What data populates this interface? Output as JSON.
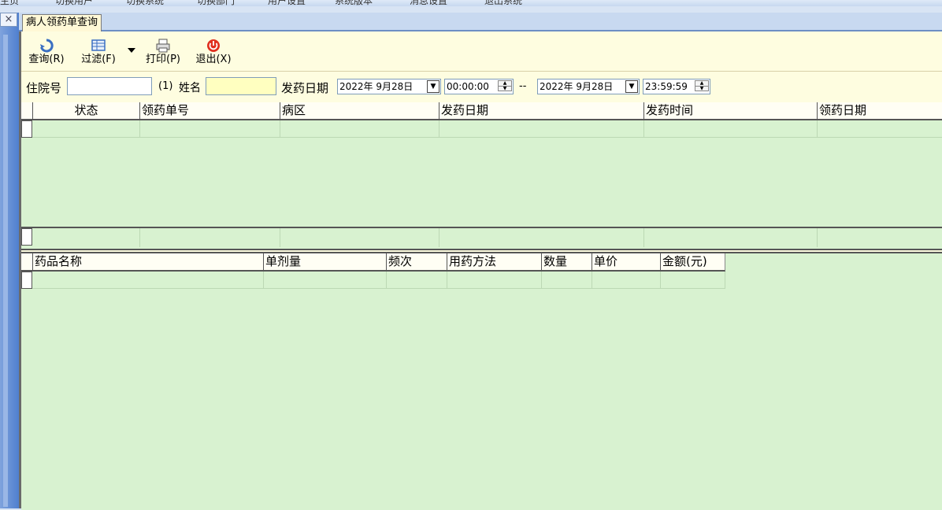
{
  "top_menu": [
    "主页",
    "切换用户",
    "切换系统",
    "切换部门",
    "用户设置",
    "系统版本",
    "消息设置",
    "退出系统"
  ],
  "close_glyph": "×",
  "tab": {
    "label": "病人领药单查询"
  },
  "toolbar": {
    "query": "查询(R)",
    "filter": "过滤(F)",
    "print": "打印(P)",
    "exit": "退出(X)"
  },
  "filter_bar": {
    "inpatient_no_label": "住院号",
    "hint": "(1)",
    "name_label": "姓名",
    "inpatient_no_value": "",
    "name_value": "",
    "dispense_date_label": "发药日期",
    "start_date": "2022年  9月28日",
    "start_time": "00:00:00",
    "range_sep": "--",
    "end_date": "2022年  9月28日",
    "end_time": "23:59:59"
  },
  "upper_table": {
    "columns": [
      "状态",
      "领药单号",
      "病区",
      "发药日期",
      "发药时间",
      "领药日期"
    ]
  },
  "lower_table": {
    "columns": [
      "药品名称",
      "单剂量",
      "频次",
      "用药方法",
      "数量",
      "单价",
      "金额(元)"
    ]
  },
  "colors": {
    "grid_bg": "#d8f2d0",
    "panel_bg": "#fefde0",
    "tab_bg": "#fff8d6",
    "name_field_bg": "#ffffc0"
  }
}
